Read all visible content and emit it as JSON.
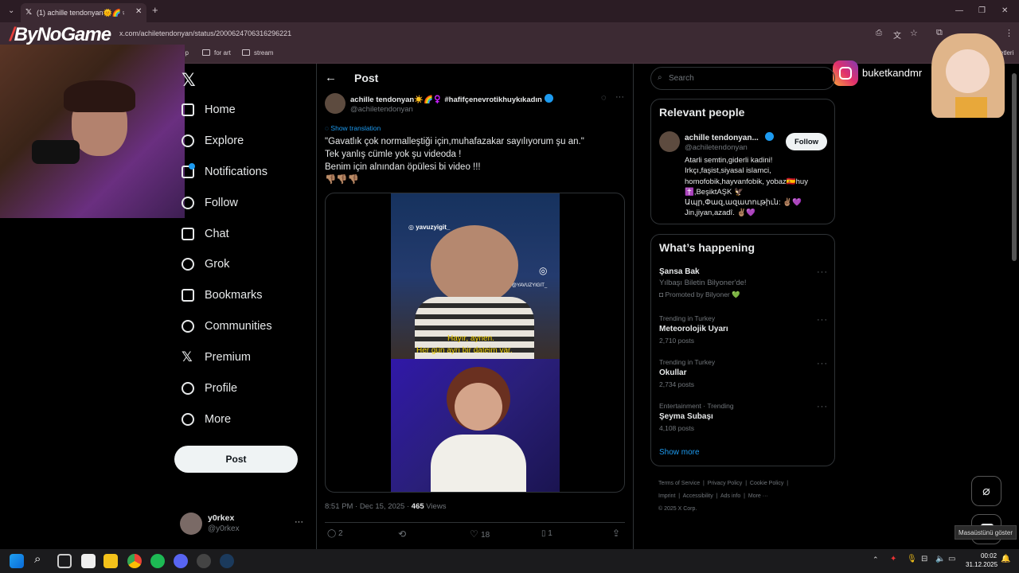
{
  "browser": {
    "tab_title": "(1) achille tendonyan🌞🌈♀ ",
    "url": "x.com/achiletendonyan/status/2000624706316296221",
    "bookmarks": [
      "op",
      "for art",
      "stream"
    ],
    "bookmarks_overflow": "etleri"
  },
  "overlay": {
    "logo_text": "ByNoGame",
    "instagram_handle": "buketkandmr"
  },
  "nav": {
    "items": [
      {
        "label": "Home",
        "icon": "home-icon"
      },
      {
        "label": "Explore",
        "icon": "search-icon"
      },
      {
        "label": "Notifications",
        "icon": "bell-icon"
      },
      {
        "label": "Follow",
        "icon": "person-add-icon"
      },
      {
        "label": "Chat",
        "icon": "mail-icon"
      },
      {
        "label": "Grok",
        "icon": "grok-icon"
      },
      {
        "label": "Bookmarks",
        "icon": "bookmark-icon"
      },
      {
        "label": "Communities",
        "icon": "communities-icon"
      },
      {
        "label": "Premium",
        "icon": "x-icon"
      },
      {
        "label": "Profile",
        "icon": "profile-icon"
      },
      {
        "label": "More",
        "icon": "more-icon"
      }
    ],
    "post_button": "Post",
    "account": {
      "name": "y0rkex",
      "handle": "@y0rkex"
    }
  },
  "post": {
    "header": "Post",
    "author_name": "achille tendonyan☀️🌈♀️ #hafifçenevrotikhuykıkadın",
    "author_handle": "@achiletendonyan",
    "show_translation": "Show translation",
    "text_lines": [
      "\"Gavatlık çok normalleştiği için,muhafazakar sayılıyorum şu an.\"",
      "Tek yanlış cümle yok şu videoda !",
      "Benim için alnından öpülesi bi video !!!",
      "👎🏽👎🏽👎🏽"
    ],
    "video": {
      "watermark": "yavuzyigit_",
      "watermark2": "@YAVUZYIGIT_",
      "subtitle_1": "Hayır, aynen.",
      "subtitle_2": "Her gün ayrı bir dateim var."
    },
    "timestamp": "8:51 PM · Dec 15, 2025 · ",
    "views_count": "465",
    "views_label": " Views",
    "actions": {
      "replies": "2",
      "reposts": "",
      "likes": "18",
      "bookmarks": "1"
    }
  },
  "sidebar": {
    "search_placeholder": "Search",
    "relevant": {
      "title": "Relevant people",
      "name": "achille tendonyan...",
      "handle": "@achiletendonyan",
      "follow": "Follow",
      "bio": "Atarli semtin,giderli kadini! Irkçı,faşist,siyasal islamci, homofobik,hayvanfobik, yobaz🇪🇸huy ✝️,BeşiktAŞK 🦅 Ապր,Փազ,ազատութիւն: ✌🏽💜 Jin,jiyan,azadî. ✌🏽💜"
    },
    "happening": {
      "title": "What’s happening",
      "items": [
        {
          "meta": "",
          "title": "Şansa Bak",
          "sub": "Yılbaşı Biletin Bilyoner'de!",
          "foot": "Promoted by Bilyoner 💚"
        },
        {
          "meta": "Trending in Turkey",
          "title": "Meteorolojik Uyarı",
          "sub": "",
          "foot": "2,710 posts"
        },
        {
          "meta": "Trending in Turkey",
          "title": "Okullar",
          "sub": "",
          "foot": "2,734 posts"
        },
        {
          "meta": "Entertainment · Trending",
          "title": "Şeyma Subaşı",
          "sub": "",
          "foot": "4,108 posts"
        }
      ],
      "show_more": "Show more"
    },
    "footer_links": [
      "Terms of Service",
      "Privacy Policy",
      "Cookie Policy",
      "Imprint",
      "Accessibility",
      "Ads info",
      "More ···",
      "© 2025 X Corp."
    ]
  },
  "tooltip": "Masaüstünü göster",
  "taskbar": {
    "time": "00:02",
    "date": "31.12.2025"
  }
}
